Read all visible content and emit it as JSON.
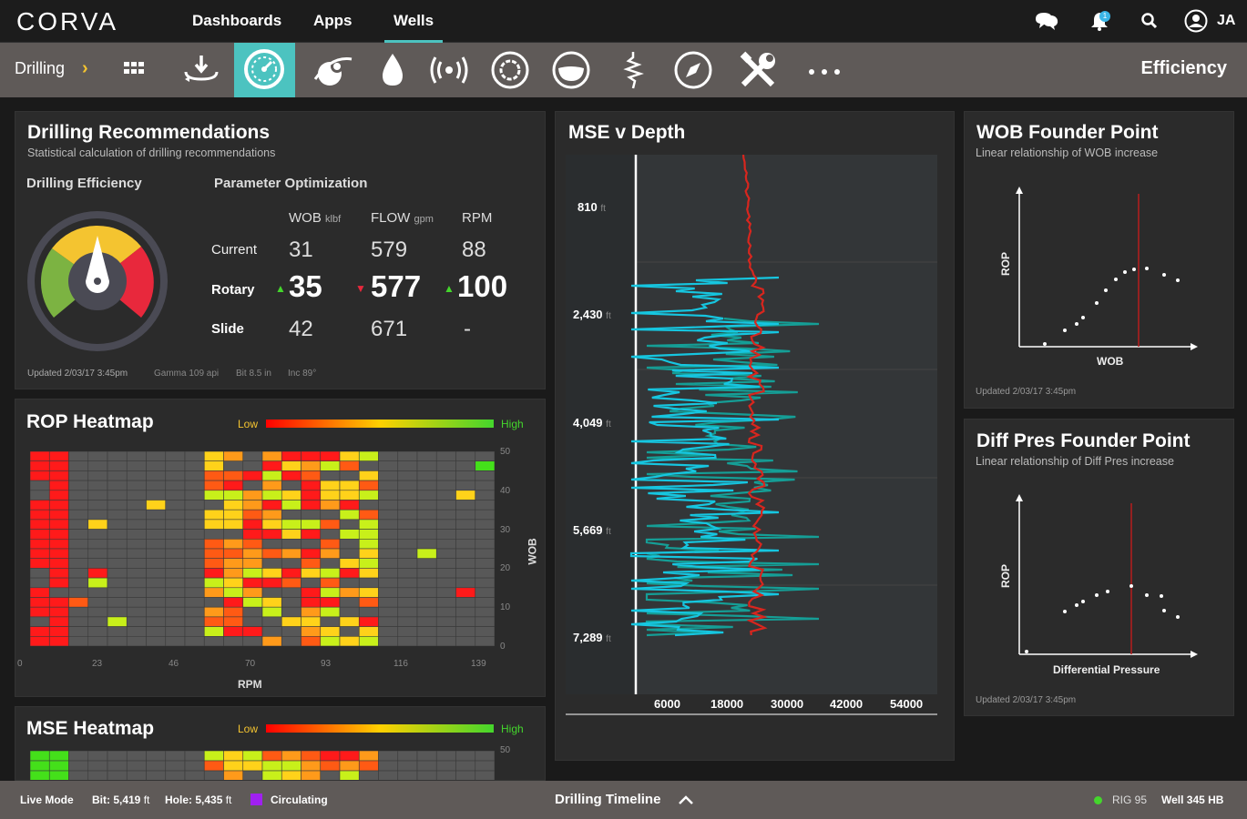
{
  "header": {
    "logo": "CORVA",
    "nav": [
      "Dashboards",
      "Apps",
      "Wells"
    ],
    "active_nav": "Wells",
    "notification_count": "1",
    "user_initials": "JA"
  },
  "toolbar": {
    "breadcrumb": "Drilling",
    "section_title": "Efficiency",
    "icons": [
      "grid-icon",
      "download-rotate-icon",
      "gauge-icon",
      "planet-icon",
      "drop-icon",
      "broadcast-icon",
      "gear-ring-icon",
      "bowl-icon",
      "seismic-icon",
      "compass-icon",
      "tools-icon",
      "more-icon"
    ],
    "active_icon": "gauge-icon",
    "accent_color": "#4cc3c0"
  },
  "recommendations": {
    "title": "Drilling Recommendations",
    "subtitle": "Statistical calculation of drilling recommendations",
    "efficiency_label": "Drilling Efficiency",
    "optimization_label": "Parameter Optimization",
    "headers": [
      {
        "name": "WOB",
        "unit": "klbf"
      },
      {
        "name": "FLOW",
        "unit": "gpm"
      },
      {
        "name": "RPM",
        "unit": ""
      }
    ],
    "rows": [
      {
        "label": "Current",
        "values": [
          "31",
          "579",
          "88"
        ]
      },
      {
        "label": "Rotary",
        "values": [
          "35",
          "577",
          "100"
        ],
        "trends": [
          "up",
          "down",
          "up"
        ]
      },
      {
        "label": "Slide",
        "values": [
          "42",
          "671",
          "-"
        ]
      }
    ],
    "footer": [
      "Updated 2/03/17 3:45pm",
      "Gamma 109 api",
      "Bit 8.5 in",
      "Inc 89°"
    ],
    "gauge_value": 0.5
  },
  "rop_heatmap": {
    "title": "ROP Heatmap",
    "low": "Low",
    "high": "High",
    "x_ticks": [
      "0",
      "23",
      "46",
      "70",
      "93",
      "116",
      "139"
    ],
    "y_ticks": [
      "50",
      "40",
      "30",
      "20",
      "10",
      "0"
    ],
    "xlabel": "RPM",
    "ylabel": "WOB"
  },
  "mse_heatmap": {
    "title": "MSE Heatmap",
    "low": "Low",
    "high": "High",
    "y_top": "50"
  },
  "mse_depth": {
    "title": "MSE v Depth",
    "depth_labels": [
      "810",
      "2,430",
      "4,049",
      "5,669",
      "7,289"
    ],
    "depth_unit": "ft",
    "x_ticks": [
      "6000",
      "18000",
      "30000",
      "42000",
      "54000"
    ]
  },
  "wob_founder": {
    "title": "WOB Founder Point",
    "subtitle": "Linear relationship of WOB increase",
    "xlabel": "WOB",
    "ylabel": "ROP",
    "updated": "Updated 2/03/17 3:45pm"
  },
  "diff_founder": {
    "title": "Diff Pres Founder Point",
    "subtitle": "Linear relationship of Diff Pres increase",
    "xlabel": "Differential Pressure",
    "ylabel": "ROP",
    "updated": "Updated 2/03/17 3:45pm"
  },
  "status": {
    "mode": "Live Mode",
    "bit": "Bit: 5,419",
    "bit_unit": "ft",
    "hole": "Hole: 5,435",
    "hole_unit": "ft",
    "state": "Circulating",
    "timeline": "Drilling Timeline",
    "rig": "RIG 95",
    "well": "Well 345 HB"
  }
}
